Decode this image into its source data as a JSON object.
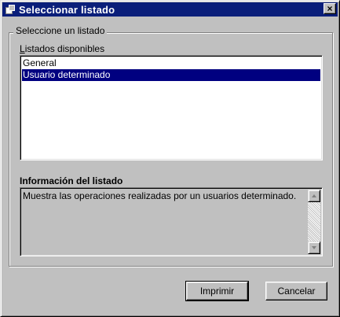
{
  "window": {
    "title": "Seleccionar listado",
    "close_label": "×",
    "app_icon": "app-window-icon"
  },
  "group": {
    "legend": "Seleccione un listado"
  },
  "list": {
    "label_mnemonic": "L",
    "label_rest": "istados disponibles",
    "items": [
      {
        "label": "General",
        "selected": false
      },
      {
        "label": "Usuario determinado",
        "selected": true
      }
    ]
  },
  "info": {
    "heading": "Información del listado",
    "text": "Muestra las operaciones realizadas por un usuarios determinado."
  },
  "buttons": {
    "print": "Imprimir",
    "cancel": "Cancelar"
  },
  "colors": {
    "titlebar": "#0a1e7a",
    "selection": "#000080",
    "face": "#c0c0c0"
  }
}
